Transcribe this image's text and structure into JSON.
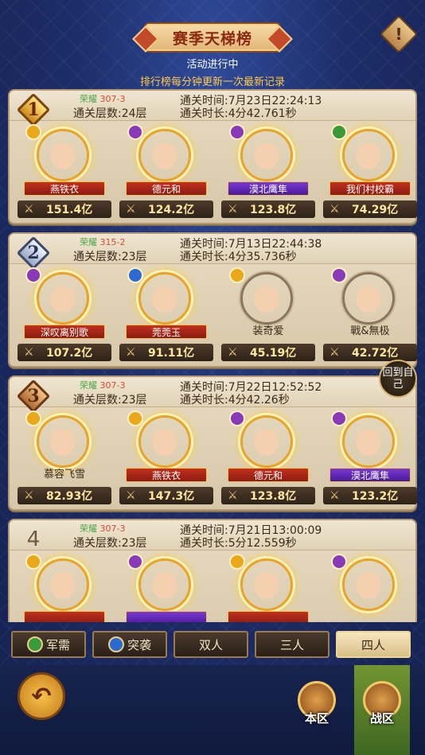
{
  "header": {
    "title": "赛季天梯榜",
    "status": "活动进行中",
    "info": "排行榜每分钟更新一次最新记录",
    "warn_icon": "!"
  },
  "cards": [
    {
      "rank": "1",
      "glory": "荣耀",
      "glory_sub": "307-3",
      "floors": "通关层数:24层",
      "pass_time": "通关时间:7月23日22:24:13",
      "duration": "通关时长:4分42.761秒",
      "heroes": [
        {
          "name": "燕铁衣",
          "power": "151.4亿",
          "class_color": "gold",
          "ribbon": "red"
        },
        {
          "name": "德元和",
          "power": "124.2亿",
          "class_color": "purple",
          "ribbon": "red"
        },
        {
          "name": "漠北鹰隼",
          "power": "123.8亿",
          "class_color": "purple",
          "ribbon": "purple"
        },
        {
          "name": "我们村校霸",
          "power": "74.29亿",
          "class_color": "green",
          "ribbon": "red"
        }
      ]
    },
    {
      "rank": "2",
      "glory": "荣耀",
      "glory_sub": "315-2",
      "floors": "通关层数:23层",
      "pass_time": "通关时间:7月13日22:44:38",
      "duration": "通关时长:4分35.736秒",
      "heroes": [
        {
          "name": "深叹离别歌",
          "power": "107.2亿",
          "class_color": "purple",
          "ribbon": "red"
        },
        {
          "name": "莞莞玉",
          "power": "91.11亿",
          "class_color": "blue",
          "ribbon": "red"
        },
        {
          "name": "装奇爱",
          "power": "45.19亿",
          "class_color": "gold",
          "ribbon": "none"
        },
        {
          "name": "戰&無极",
          "power": "42.72亿",
          "class_color": "purple",
          "ribbon": "none"
        }
      ]
    },
    {
      "rank": "3",
      "glory": "荣耀",
      "glory_sub": "307-3",
      "floors": "通关层数:23层",
      "pass_time": "通关时间:7月22日12:52:52",
      "duration": "通关时长:4分42.26秒",
      "heroes": [
        {
          "name": "慕容飞雪",
          "power": "82.93亿",
          "class_color": "gold",
          "ribbon": "none"
        },
        {
          "name": "燕铁衣",
          "power": "147.3亿",
          "class_color": "gold",
          "ribbon": "red"
        },
        {
          "name": "德元和",
          "power": "123.8亿",
          "class_color": "purple",
          "ribbon": "red"
        },
        {
          "name": "漠北鹰隼",
          "power": "123.2亿",
          "class_color": "purple",
          "ribbon": "purple"
        }
      ]
    },
    {
      "rank": "4",
      "glory": "荣耀",
      "glory_sub": "307-3",
      "floors": "通关层数:23层",
      "pass_time": "通关时间:7月21日13:00:09",
      "duration": "通关时长:5分12.559秒",
      "heroes": [
        {
          "name": "",
          "power": "",
          "class_color": "gold",
          "ribbon": "red"
        },
        {
          "name": "",
          "power": "",
          "class_color": "purple",
          "ribbon": "purple"
        },
        {
          "name": "",
          "power": "",
          "class_color": "gold",
          "ribbon": "red"
        },
        {
          "name": "",
          "power": "",
          "class_color": "purple",
          "ribbon": "none"
        }
      ]
    }
  ],
  "back_to_self": "回到自己",
  "tabs": [
    {
      "label": "军需",
      "icon": "green"
    },
    {
      "label": "突袭",
      "icon": "blue"
    },
    {
      "label": "双人"
    },
    {
      "label": "三人"
    },
    {
      "label": "四人",
      "active": true
    }
  ],
  "bottom": {
    "return_icon": "↶",
    "local_zone": "本区",
    "war_zone": "战区"
  }
}
